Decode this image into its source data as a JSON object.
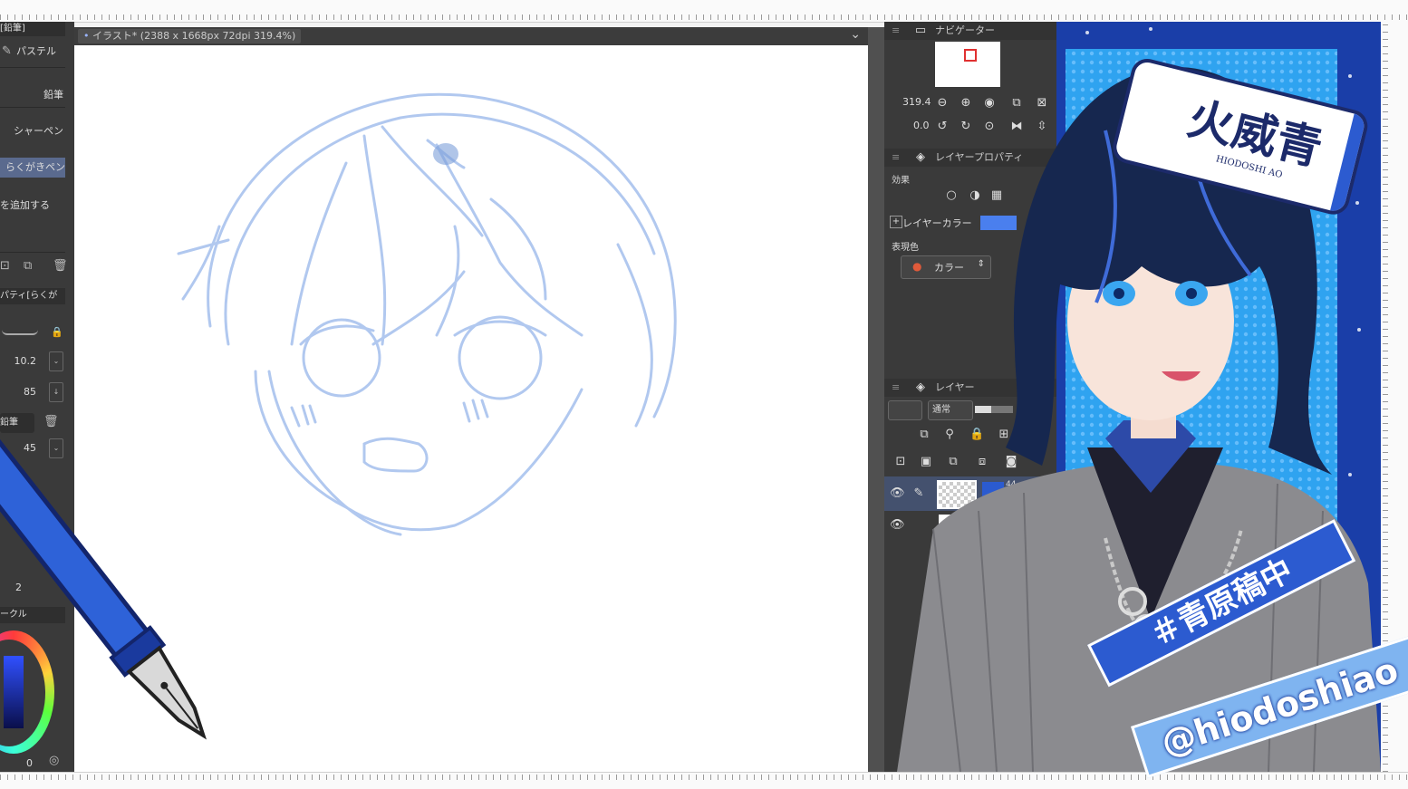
{
  "left_panel": {
    "header_fragment": "[鉛筆]",
    "brush_group": "パステル",
    "brushes": [
      "鉛筆",
      "シャーペン",
      "らくがきペン"
    ],
    "add_brush": "を追加する",
    "tool_property_title": "パティ[らくが",
    "size_value": "10.2",
    "opacity_value": "85",
    "preset_label": "鉛筆",
    "param_value": "45",
    "small_value": "2",
    "color_wheel_label": "ークル",
    "color_value": "0",
    "icons": [
      "pencil-icon",
      "duplicate-icon",
      "trash-icon",
      "lock-icon",
      "chevron-down-icon",
      "download-icon"
    ]
  },
  "canvas_tab": {
    "label": "イラスト* (2388 x 1668px 72dpi 319.4%)",
    "chevron": "⌄"
  },
  "navigator": {
    "title": "ナビゲーター",
    "zoom_value": "319.4",
    "rotation_value": "0.0",
    "icons": [
      "zoom-out-icon",
      "zoom-in-icon",
      "fit-icon",
      "actual-size-icon",
      "fit-window-icon",
      "rotate-left-icon",
      "rotate-right-icon",
      "reset-rotation-icon",
      "flip-horizontal-icon",
      "flip-vertical-icon"
    ]
  },
  "layer_property": {
    "title": "レイヤープロパティ",
    "effect_label": "効果",
    "layer_color_label": "レイヤーカラー",
    "layer_color": "#4a7fee",
    "expression_label": "表現色",
    "expression_value": "カラー"
  },
  "layer_panel": {
    "title": "レイヤー",
    "blend_mode": "通常",
    "opacity_value": "44",
    "layer_thumb_label": "44",
    "icons": [
      "eye-icon",
      "pen-icon",
      "lock-icon",
      "folder-icon",
      "mask-icon"
    ]
  },
  "overlay": {
    "name_badge": "火威青",
    "name_badge_romaji": "HIODOSHI AO",
    "hashtag": "＃青原稿中",
    "handle": "@hiodoshiao"
  },
  "colors": {
    "sketch": "#a9c3ee",
    "accent_blue": "#2c5bd0",
    "panel_bg": "#3a3a3a"
  }
}
